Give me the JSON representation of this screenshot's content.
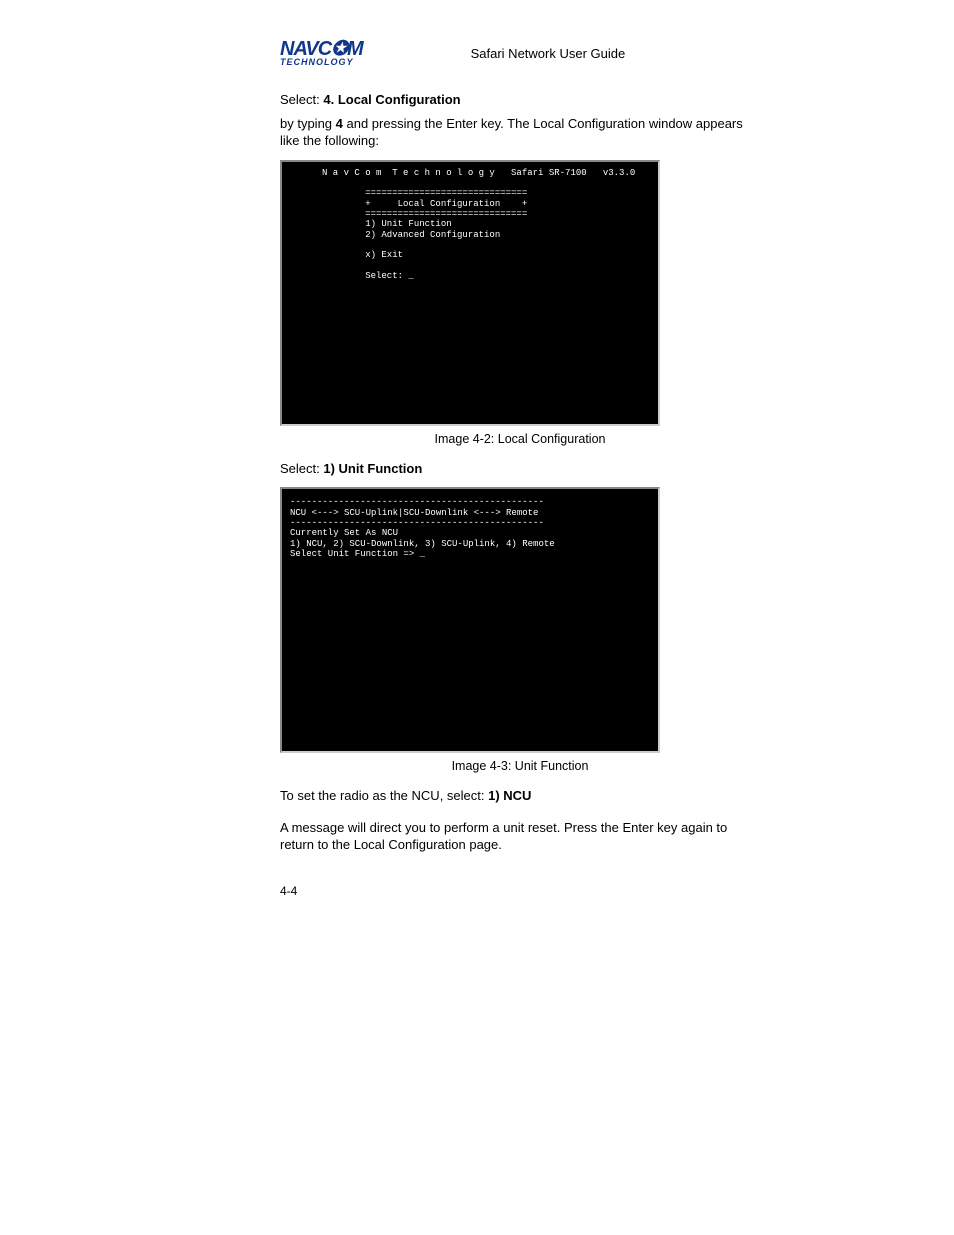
{
  "header": {
    "logo_main": "NAVC✪M",
    "logo_sub": "TECHNOLOGY",
    "guide_title": "Safari Network User Guide"
  },
  "body": {
    "select1_prefix": "Select: ",
    "select1_bold": "4. Local Configuration",
    "para1_a": "by typing ",
    "para1_bold": "4",
    "para1_b": " and pressing the Enter key. The Local Configuration window appears like the following:",
    "terminal1": "N a v C o m  T e c h n o l o g y   Safari SR-7100   v3.3.0\n\n        ==============================\n        +     Local Configuration    +\n        ==============================\n        1) Unit Function\n        2) Advanced Configuration\n\n        x) Exit\n\n        Select: _",
    "caption1": "Image 4-2: Local Configuration",
    "select2_prefix": "Select: ",
    "select2_bold": "1) Unit Function",
    "terminal2": "-----------------------------------------------\nNCU <---> SCU-Uplink|SCU-Downlink <---> Remote\n-----------------------------------------------\nCurrently Set As NCU\n1) NCU, 2) SCU-Downlink, 3) SCU-Uplink, 4) Remote\nSelect Unit Function => _",
    "caption2": "Image 4-3: Unit Function",
    "para2_a": "To set the radio as the NCU, select: ",
    "para2_bold": "1) NCU",
    "para3": "A message will direct you to perform a unit reset. Press the Enter key again to return to the Local Configuration page.",
    "pagenum": "4-4"
  }
}
